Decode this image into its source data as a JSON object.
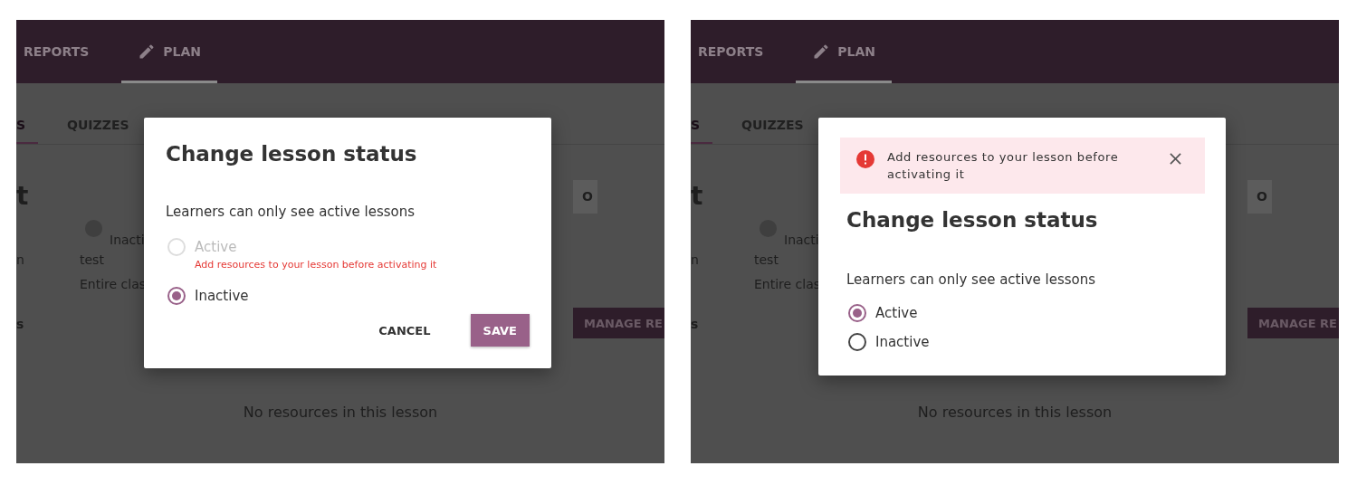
{
  "panels": [
    {
      "nav_tabs": [
        {
          "label": "REPORTS",
          "selected": false,
          "with_icon": false
        },
        {
          "label": "PLAN",
          "selected": true,
          "with_icon": true
        }
      ],
      "sub_tabs": [
        {
          "label": "S",
          "selected": true
        },
        {
          "label": "QUIZZES",
          "selected": false
        }
      ],
      "lesson": {
        "title": "t",
        "status_label": "Inacti",
        "details": [
          {
            "label": "n",
            "value": "test"
          },
          {
            "value": "Entire clas"
          }
        ],
        "section_label": "s",
        "options_button": "O",
        "manage_button": "MANAGE RE",
        "empty_message": "No resources in this lesson"
      },
      "modal": {
        "title": "Change lesson status",
        "description": "Learners can only see active lessons",
        "options": [
          {
            "label": "Active",
            "selected": false,
            "disabled": true,
            "error": "Add resources to your lesson before activating it"
          },
          {
            "label": "Inactive",
            "selected": true,
            "disabled": false
          }
        ],
        "buttons": [
          {
            "label": "CANCEL",
            "kind": "flat"
          },
          {
            "label": "SAVE",
            "kind": "raised"
          }
        ]
      }
    },
    {
      "nav_tabs": [
        {
          "label": "REPORTS",
          "selected": false,
          "with_icon": false
        },
        {
          "label": "PLAN",
          "selected": true,
          "with_icon": true
        }
      ],
      "sub_tabs": [
        {
          "label": "S",
          "selected": true
        },
        {
          "label": "QUIZZES",
          "selected": false
        }
      ],
      "lesson": {
        "title": "t",
        "status_label": "Inacti",
        "details": [
          {
            "label": "n",
            "value": "test"
          },
          {
            "value": "Entire clas"
          }
        ],
        "section_label": "s",
        "options_button": "O",
        "manage_button": "MANAGE RE",
        "empty_message": "No resources in this lesson"
      },
      "modal": {
        "alert": {
          "message": "Add resources to your lesson before activating it"
        },
        "title": "Change lesson status",
        "description": "Learners can only see active lessons",
        "options": [
          {
            "label": "Active",
            "selected": true,
            "disabled": false
          },
          {
            "label": "Inactive",
            "selected": false,
            "disabled": false
          }
        ]
      }
    }
  ]
}
